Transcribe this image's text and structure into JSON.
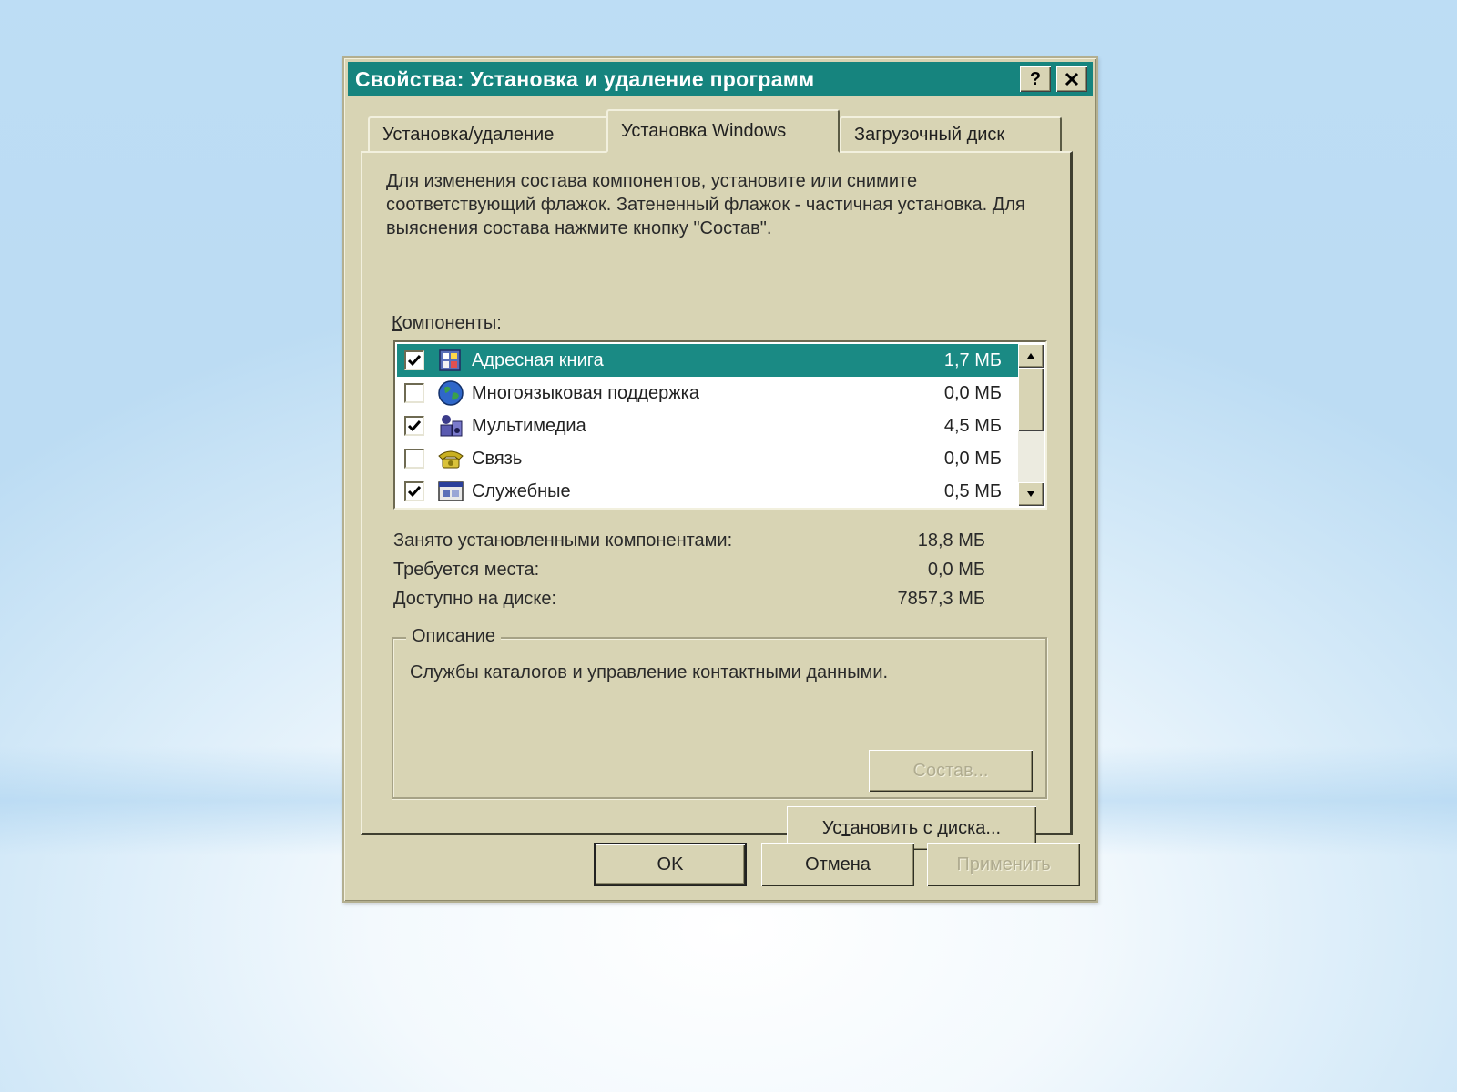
{
  "window": {
    "title": "Свойства: Установка и удаление программ",
    "help_glyph": "?",
    "accent": "#16847e",
    "face": "#d8d4b4"
  },
  "tabs": [
    {
      "label": "Установка/удаление",
      "active": false
    },
    {
      "label": "Установка Windows",
      "active": true
    },
    {
      "label": "Загрузочный диск",
      "active": false
    }
  ],
  "intro_text": "Для изменения состава компонентов, установите или снимите соответствующий флажок. Затененный флажок - частичная установка. Для выяснения состава нажмите кнопку \"Состав\".",
  "components": {
    "label_first": "К",
    "label_rest": "омпоненты:",
    "items": [
      {
        "name": "Адресная книга",
        "size": "1,7 МБ",
        "checked": true,
        "selected": true,
        "icon": "address-book-icon"
      },
      {
        "name": "Многоязыковая поддержка",
        "size": "0,0 МБ",
        "checked": false,
        "selected": false,
        "icon": "globe-icon"
      },
      {
        "name": "Мультимедиа",
        "size": "4,5 МБ",
        "checked": true,
        "selected": false,
        "icon": "multimedia-icon"
      },
      {
        "name": "Связь",
        "size": "0,0 МБ",
        "checked": false,
        "selected": false,
        "icon": "phone-icon"
      },
      {
        "name": "Служебные",
        "size": "0,5 МБ",
        "checked": true,
        "selected": false,
        "icon": "system-tools-icon"
      }
    ]
  },
  "stats": [
    {
      "label": "Занято установленными компонентами:",
      "value": "18,8 МБ"
    },
    {
      "label": "Требуется места:",
      "value": "0,0 МБ"
    },
    {
      "label": "Доступно на диске:",
      "value": "7857,3 МБ"
    }
  ],
  "description": {
    "title": "Описание",
    "text": "Службы каталогов и управление контактными данными."
  },
  "buttons": {
    "sostav": "Состав...",
    "install_a": "Ус",
    "install_u": "т",
    "install_b": "ановить с диска...",
    "ok": "OK",
    "cancel": "Отмена",
    "apply": "Применить"
  }
}
